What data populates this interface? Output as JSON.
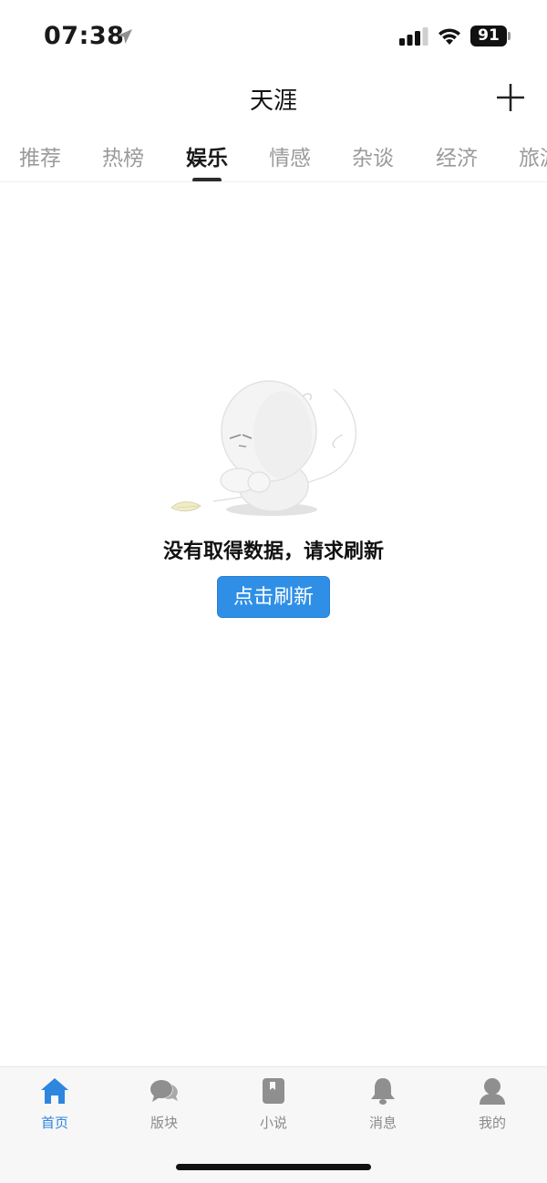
{
  "status": {
    "time": "07:38",
    "battery": "91",
    "location_icon": "location-arrow-icon",
    "signal_icon": "cellular-signal-icon",
    "wifi_icon": "wifi-icon"
  },
  "header": {
    "title": "天涯",
    "add_icon": "plus-icon"
  },
  "tabs": [
    {
      "label": "推荐",
      "active": false
    },
    {
      "label": "热榜",
      "active": false
    },
    {
      "label": "娱乐",
      "active": true
    },
    {
      "label": "情感",
      "active": false
    },
    {
      "label": "杂谈",
      "active": false
    },
    {
      "label": "经济",
      "active": false
    },
    {
      "label": "旅游",
      "active": false
    }
  ],
  "empty_state": {
    "illustration": "sad-character-illustration",
    "message": "没有取得数据，请求刷新",
    "button_label": "点击刷新"
  },
  "bottom_nav": [
    {
      "label": "首页",
      "icon": "home-icon",
      "active": true
    },
    {
      "label": "版块",
      "icon": "chat-bubbles-icon",
      "active": false
    },
    {
      "label": "小说",
      "icon": "book-icon",
      "active": false
    },
    {
      "label": "消息",
      "icon": "bell-icon",
      "active": false
    },
    {
      "label": "我的",
      "icon": "user-icon",
      "active": false
    }
  ],
  "colors": {
    "accent": "#2f8fe6",
    "nav_active": "#2e86de",
    "tab_inactive": "#9a9a9a"
  }
}
